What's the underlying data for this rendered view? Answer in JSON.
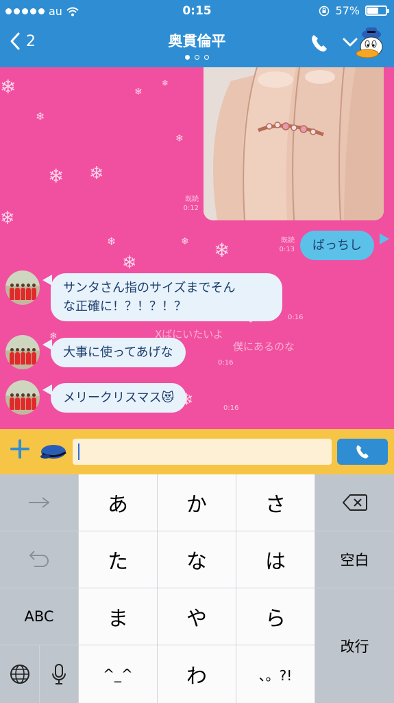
{
  "status_bar": {
    "carrier": "au",
    "time": "0:15",
    "battery": "57%",
    "battery_level": 0.57
  },
  "header": {
    "back_count": "2",
    "title": "奥貫倫平"
  },
  "messages": {
    "photo_meta": {
      "read": "既読",
      "time": "0:12"
    },
    "sent": {
      "text": "ばっちし",
      "read": "既読",
      "time": "0:13"
    },
    "received": [
      {
        "text_line1": "サンタさん指のサイズまでそん",
        "text_line2": "な正確に！？！？！？",
        "time": "0:16"
      },
      {
        "text": "大事に使ってあげな",
        "time": "0:16"
      },
      {
        "text": "メリークリスマス",
        "emoji": "😻",
        "time": "0:16"
      }
    ]
  },
  "background_text": {
    "line1": "Xばにいたいよ",
    "line2": "僕にあるのな"
  },
  "input": {
    "value": ""
  },
  "keyboard": {
    "row1": [
      "あ",
      "か",
      "さ"
    ],
    "row2": [
      "た",
      "な",
      "は"
    ],
    "row3": [
      "ま",
      "や",
      "ら"
    ],
    "row4": [
      "^_^",
      "わ",
      "、。?!"
    ],
    "abc": "ABC",
    "space": "空白",
    "return": "改行"
  },
  "colors": {
    "header": "#2f8ed3",
    "chat_bg": "#f14fa0",
    "input_bar": "#f7c546",
    "my_bubble": "#5bc1e9",
    "their_bubble": "#e8f2fb"
  }
}
